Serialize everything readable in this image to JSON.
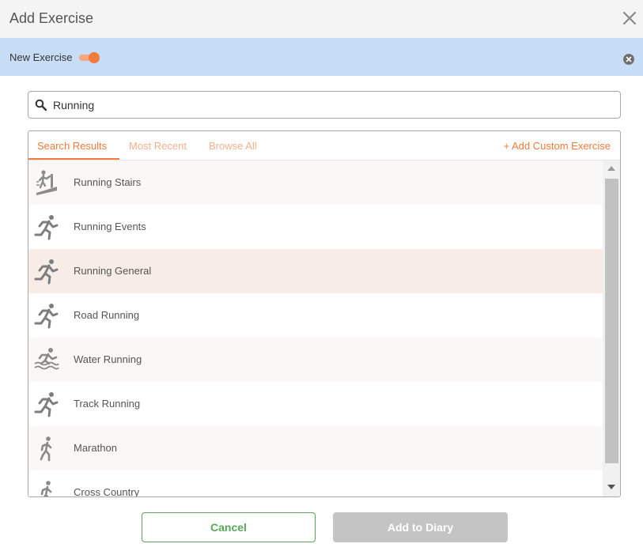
{
  "dialog": {
    "title": "Add Exercise"
  },
  "banner": {
    "toggle_label": "New Exercise",
    "toggle_on": true
  },
  "search": {
    "value": "Running",
    "placeholder": ""
  },
  "tabs": [
    {
      "label": "Search Results",
      "active": true
    },
    {
      "label": "Most Recent",
      "active": false
    },
    {
      "label": "Browse All",
      "active": false
    }
  ],
  "add_custom_label": "+ Add Custom Exercise",
  "results": [
    {
      "label": "Running Stairs",
      "icon": "stair-climber-icon",
      "bg": "#f9f8f6"
    },
    {
      "label": "Running Events",
      "icon": "runner-icon",
      "bg": "#ffffff"
    },
    {
      "label": "Running General",
      "icon": "runner-icon",
      "bg": "#f7ece6"
    },
    {
      "label": "Road Running",
      "icon": "runner-icon",
      "bg": "#ffffff"
    },
    {
      "label": "Water Running",
      "icon": "water-runner-icon",
      "bg": "#f9f8f6"
    },
    {
      "label": "Track Running",
      "icon": "runner-icon",
      "bg": "#ffffff"
    },
    {
      "label": "Marathon",
      "icon": "marathon-runner-icon",
      "bg": "#f9f8f6"
    },
    {
      "label": "Cross Country",
      "icon": "marathon-runner-icon",
      "bg": "#ffffff"
    }
  ],
  "footer": {
    "cancel_label": "Cancel",
    "add_label": "Add to Diary"
  },
  "colors": {
    "accent": "#f37b3b",
    "accent_light": "#f4b08c",
    "banner": "#c7ddf5",
    "cancel_green": "#5aa65a",
    "disabled": "#c4c4c4",
    "highlight": "#f7ece6"
  }
}
